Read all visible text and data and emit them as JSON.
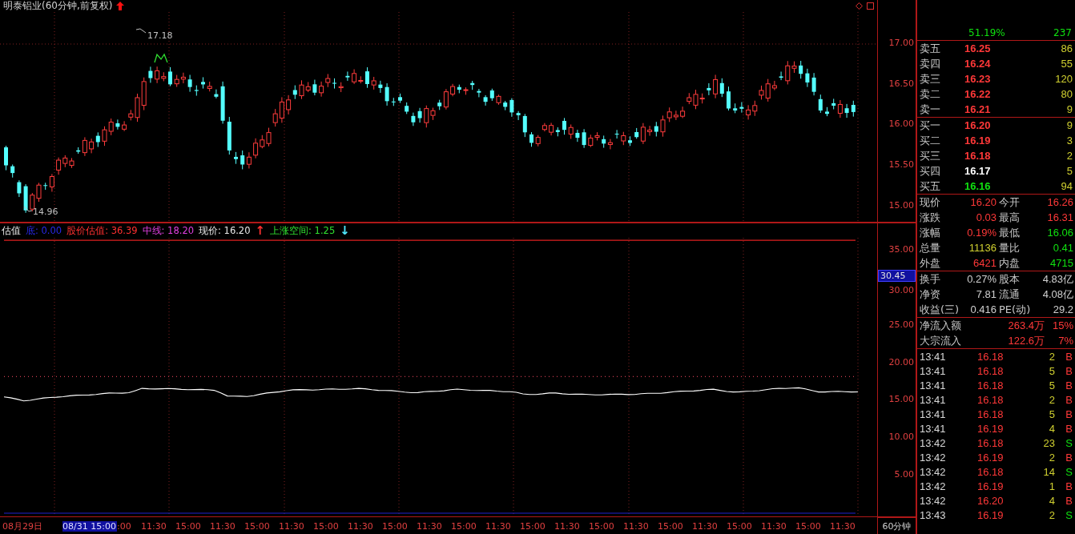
{
  "title": "明泰铝业(60分钟,前复权)",
  "price_chart": {
    "high_label": "17.18",
    "low_label": "14.96",
    "axis_labels": [
      "17.00",
      "16.50",
      "16.00",
      "15.50",
      "15.00"
    ]
  },
  "indicator": {
    "name": "估值",
    "items": [
      {
        "text": "底: 0.00",
        "color": "#2828e8"
      },
      {
        "text": "股价估值: 36.39",
        "color": "#ff3030"
      },
      {
        "text": "中线: 18.20",
        "color": "#e040e0"
      },
      {
        "text": "现价: 16.20",
        "color": "#e8e8e8"
      },
      {
        "text": "↑",
        "color": "#ff3030"
      },
      {
        "text": "上涨空间: 1.25",
        "color": "#30e030"
      },
      {
        "text": "↓",
        "color": "#50e8ff"
      }
    ]
  },
  "lower_chart": {
    "cursor_value": "30.45",
    "axis_labels": [
      "35.00",
      "30.00",
      "25.00",
      "20.00",
      "15.00",
      "10.00",
      "5.00"
    ]
  },
  "x_axis": [
    {
      "text": "08月29日",
      "selected": false
    },
    {
      "text": "08/31 15:00",
      "selected": true
    },
    {
      "text": ":00",
      "selected": false
    },
    {
      "text": "11:30",
      "selected": false
    },
    {
      "text": "15:00",
      "selected": false
    },
    {
      "text": "11:30",
      "selected": false
    },
    {
      "text": "15:00",
      "selected": false
    },
    {
      "text": "11:30",
      "selected": false
    },
    {
      "text": "15:00",
      "selected": false
    },
    {
      "text": "11:30",
      "selected": false
    },
    {
      "text": "15:00",
      "selected": false
    },
    {
      "text": "11:30",
      "selected": false
    },
    {
      "text": "15:00",
      "selected": false
    },
    {
      "text": "11:30",
      "selected": false
    },
    {
      "text": "15:00",
      "selected": false
    },
    {
      "text": "11:30",
      "selected": false
    },
    {
      "text": "15:00",
      "selected": false
    },
    {
      "text": "11:30",
      "selected": false
    },
    {
      "text": "15:00",
      "selected": false
    },
    {
      "text": "11:30",
      "selected": false
    },
    {
      "text": "15:00",
      "selected": false
    },
    {
      "text": "11:30",
      "selected": false
    },
    {
      "text": "15:00",
      "selected": false
    },
    {
      "text": "11:30",
      "selected": false
    }
  ],
  "period": "60分钟",
  "panel": {
    "top_values": [
      "51.19%",
      "237"
    ],
    "asks": [
      {
        "label": "卖五",
        "price": "16.25",
        "color": "#ff3838",
        "volume": "86"
      },
      {
        "label": "卖四",
        "price": "16.24",
        "color": "#ff3838",
        "volume": "55"
      },
      {
        "label": "卖三",
        "price": "16.23",
        "color": "#ff3838",
        "volume": "120"
      },
      {
        "label": "卖二",
        "price": "16.22",
        "color": "#ff3838",
        "volume": "80"
      },
      {
        "label": "卖一",
        "price": "16.21",
        "color": "#ff3838",
        "volume": "9"
      }
    ],
    "bids": [
      {
        "label": "买一",
        "price": "16.20",
        "color": "#ff3838",
        "volume": "9"
      },
      {
        "label": "买二",
        "price": "16.19",
        "color": "#ff3838",
        "volume": "3"
      },
      {
        "label": "买三",
        "price": "16.18",
        "color": "#ff3838",
        "volume": "2"
      },
      {
        "label": "买四",
        "price": "16.17",
        "color": "#ffffff",
        "volume": "5"
      },
      {
        "label": "买五",
        "price": "16.16",
        "color": "#10e010",
        "volume": "94"
      }
    ],
    "quote": [
      {
        "cells": [
          {
            "label": "现价",
            "value": "16.20",
            "color": "#ff3838"
          },
          {
            "label": "今开",
            "value": "16.26",
            "color": "#ff3838"
          }
        ]
      },
      {
        "cells": [
          {
            "label": "涨跌",
            "value": "0.03",
            "color": "#ff3838"
          },
          {
            "label": "最高",
            "value": "16.31",
            "color": "#ff3838"
          }
        ]
      },
      {
        "cells": [
          {
            "label": "涨幅",
            "value": "0.19%",
            "color": "#ff3838"
          },
          {
            "label": "最低",
            "value": "16.06",
            "color": "#10e010"
          }
        ]
      },
      {
        "cells": [
          {
            "label": "总量",
            "value": "11136",
            "color": "#d0d030"
          },
          {
            "label": "量比",
            "value": "0.41",
            "color": "#10e010"
          }
        ]
      },
      {
        "cells": [
          {
            "label": "外盘",
            "value": "6421",
            "color": "#ff3838"
          },
          {
            "label": "内盘",
            "value": "4715",
            "color": "#10e010"
          }
        ]
      }
    ],
    "finance": [
      {
        "cells": [
          {
            "label": "换手",
            "value": "0.27%"
          },
          {
            "label": "股本",
            "value": "4.83亿"
          }
        ]
      },
      {
        "cells": [
          {
            "label": "净资",
            "value": "7.81"
          },
          {
            "label": "流通",
            "value": "4.08亿"
          }
        ]
      },
      {
        "cells": [
          {
            "label": "收益(三)",
            "value": "0.416"
          },
          {
            "label": "PE(动)",
            "value": "29.2"
          }
        ]
      }
    ],
    "flows": [
      {
        "label": "净流入额",
        "value": "263.4万",
        "share": "15%"
      },
      {
        "label": "大宗流入",
        "value": "122.6万",
        "share": "7%"
      }
    ],
    "trades": [
      {
        "time": "13:41",
        "price": "16.18",
        "volume": "2",
        "side": "B",
        "color": "#ff3838"
      },
      {
        "time": "13:41",
        "price": "16.18",
        "volume": "5",
        "side": "B",
        "color": "#ff3838"
      },
      {
        "time": "13:41",
        "price": "16.18",
        "volume": "5",
        "side": "B",
        "color": "#ff3838"
      },
      {
        "time": "13:41",
        "price": "16.18",
        "volume": "2",
        "side": "B",
        "color": "#ff3838"
      },
      {
        "time": "13:41",
        "price": "16.18",
        "volume": "5",
        "side": "B",
        "color": "#ff3838"
      },
      {
        "time": "13:41",
        "price": "16.19",
        "volume": "4",
        "side": "B",
        "color": "#ff3838"
      },
      {
        "time": "13:42",
        "price": "16.18",
        "volume": "23",
        "side": "S",
        "color": "#10e010"
      },
      {
        "time": "13:42",
        "price": "16.19",
        "volume": "2",
        "side": "B",
        "color": "#ff3838"
      },
      {
        "time": "13:42",
        "price": "16.18",
        "volume": "14",
        "side": "S",
        "color": "#10e010"
      },
      {
        "time": "13:42",
        "price": "16.19",
        "volume": "1",
        "side": "B",
        "color": "#ff3838"
      },
      {
        "time": "13:42",
        "price": "16.20",
        "volume": "4",
        "side": "B",
        "color": "#ff3838"
      },
      {
        "time": "13:43",
        "price": "16.19",
        "volume": "2",
        "side": "S",
        "color": "#10e010"
      }
    ]
  }
}
